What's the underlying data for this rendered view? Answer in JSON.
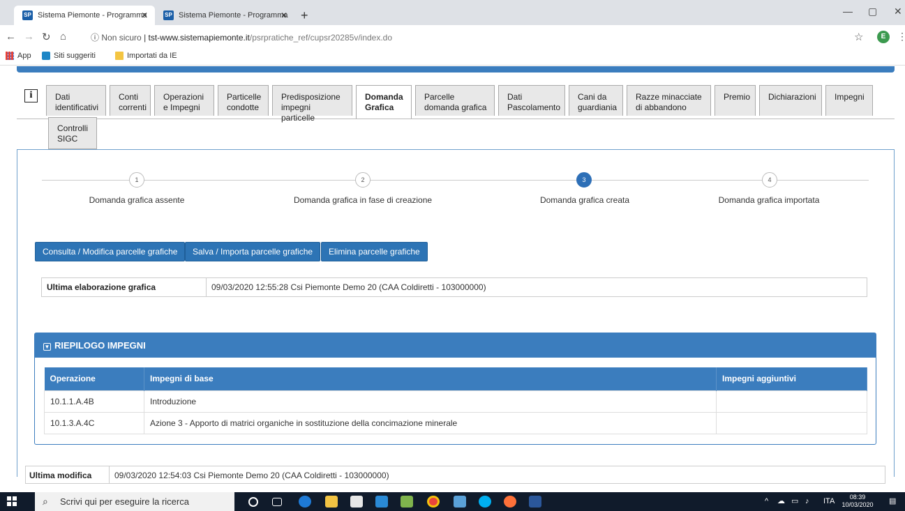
{
  "browser": {
    "tabs": [
      {
        "title": "Sistema Piemonte - Programma",
        "favicon": "SP"
      },
      {
        "title": "Sistema Piemonte - Programma",
        "favicon": "SP"
      }
    ],
    "address": {
      "not_secure": "Non sicuro",
      "host": "tst-www.sistemapiemonte.it",
      "path": "/psrpratiche_ref/cupsr20285v/index.do"
    },
    "profile_initial": "E",
    "bookmarks": [
      {
        "label": "App"
      },
      {
        "label": "Siti suggeriti"
      },
      {
        "label": "Importati da IE"
      }
    ]
  },
  "page": {
    "tabs": [
      {
        "label": "Dati identificativi"
      },
      {
        "label": "Conti correnti"
      },
      {
        "label": "Operazioni e Impegni"
      },
      {
        "label": "Particelle condotte"
      },
      {
        "label": "Predisposizione impegni particelle"
      },
      {
        "label": "Domanda Grafica"
      },
      {
        "label": "Parcelle domanda grafica"
      },
      {
        "label": "Dati Pascolamento"
      },
      {
        "label": "Cani da guardiania"
      },
      {
        "label": "Razze minacciate di abbandono"
      },
      {
        "label": "Premio"
      },
      {
        "label": "Dichiarazioni"
      },
      {
        "label": "Impegni"
      },
      {
        "label": "Controlli SIGC"
      }
    ],
    "active_tab": "Domanda Grafica",
    "steps": [
      {
        "num": "1",
        "label": "Domanda grafica assente"
      },
      {
        "num": "2",
        "label": "Domanda grafica in fase di creazione"
      },
      {
        "num": "3",
        "label": "Domanda grafica creata"
      },
      {
        "num": "4",
        "label": "Domanda grafica importata"
      }
    ],
    "current_step": 3,
    "buttons": {
      "consulta": "Consulta / Modifica parcelle grafiche",
      "salva": "Salva / Importa parcelle grafiche",
      "elimina": "Elimina parcelle grafiche"
    },
    "ultima_elaborazione": {
      "label": "Ultima elaborazione grafica",
      "value": "09/03/2020 12:55:28 Csi Piemonte Demo 20 (CAA Coldiretti - 103000000)"
    },
    "riepilogo": {
      "title": "RIEPILOGO IMPEGNI",
      "columns": [
        "Operazione",
        "Impegni di base",
        "Impegni aggiuntivi"
      ],
      "rows": [
        [
          "10.1.1.A.4B",
          "Introduzione",
          ""
        ],
        [
          "10.1.3.A.4C",
          "Azione 3 - Apporto di matrici organiche in sostituzione della concimazione minerale",
          ""
        ]
      ]
    },
    "ultima_modifica": {
      "label": "Ultima modifica",
      "value": "09/03/2020 12:54:03 Csi Piemonte Demo 20 (CAA Coldiretti - 103000000)"
    }
  },
  "taskbar": {
    "search_placeholder": "Scrivi qui per eseguire la ricerca",
    "language": "ITA",
    "time": "08:39",
    "date": "10/03/2020"
  }
}
